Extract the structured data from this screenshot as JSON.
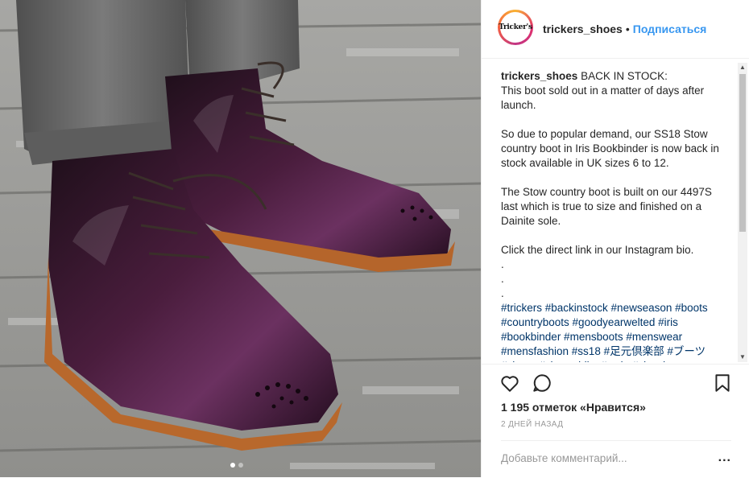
{
  "post": {
    "image_alt": "Burgundy polished brogue country boots on a weathered wooden floor",
    "carousel": {
      "count": 2,
      "active_index": 0
    }
  },
  "header": {
    "avatar_text": "Tricker's",
    "username": "trickers_shoes",
    "separator": "•",
    "follow_label": "Подписаться"
  },
  "caption": {
    "username": "trickers_shoes",
    "text": " BACK IN STOCK:\nThis boot sold out in a matter of days after launch.\n\nSo due to popular demand, our SS18 Stow country boot in Iris Bookbinder is now back in stock available in UK sizes 6 to 12.\n\nThe Stow country boot is built on our 4497S last which is true to size and finished on a Dainite sole.\n\nClick the direct link in our Instagram bio.\n.\n.\n.",
    "hashtags": "#trickers #backinstock #newseason #boots #countryboots #goodyearwelted #iris #bookbinder #mensboots #menswear #mensfashion #ss18 #足元倶楽部 #ブーツ #shoes #shoeaddict #style #classic"
  },
  "actions": {
    "like_icon": "heart-icon",
    "comment_icon": "comment-icon",
    "save_icon": "bookmark-icon",
    "likes_text": "1 195 отметок «Нравится»",
    "time_text": "2 ДНЕЙ НАЗАД",
    "comment_placeholder": "Добавьте комментарий...",
    "more_label": "..."
  },
  "colors": {
    "accent": "#3897f0",
    "hashtag": "#003569",
    "muted": "#999999",
    "text": "#262626"
  }
}
